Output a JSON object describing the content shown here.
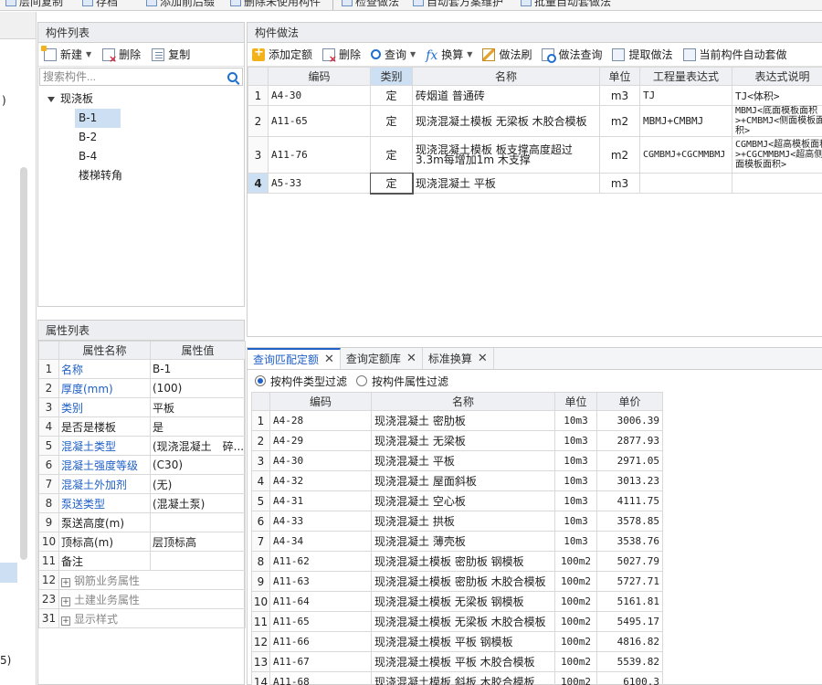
{
  "topbar": {
    "items": [
      "层间复制",
      "存档",
      "添加前后缀",
      "删除未使用构件",
      "检查做法",
      "自动套方案维护",
      "批量自动套做法"
    ]
  },
  "left_strip": {
    "glyph_a": ")",
    "glyph_b": "5)"
  },
  "component_list": {
    "title": "构件列表",
    "toolbar": {
      "new": "新建",
      "delete": "删除",
      "copy": "复制"
    },
    "search_placeholder": "搜索构件...",
    "tree": {
      "root": "现浇板",
      "children": [
        "B-1",
        "B-2",
        "B-4",
        "楼梯转角"
      ]
    }
  },
  "property_list": {
    "title": "属性列表",
    "headers": {
      "name": "属性名称",
      "value": "属性值"
    },
    "rows": [
      {
        "no": "1",
        "name": "名称",
        "value": "B-1"
      },
      {
        "no": "2",
        "name": "厚度(mm)",
        "value": "(100)"
      },
      {
        "no": "3",
        "name": "类别",
        "value": "平板"
      },
      {
        "no": "4",
        "name": "是否是楼板",
        "value": "是"
      },
      {
        "no": "5",
        "name": "混凝土类型",
        "value": "(现浇混凝土　碎..."
      },
      {
        "no": "6",
        "name": "混凝土强度等级",
        "value": "(C30)"
      },
      {
        "no": "7",
        "name": "混凝土外加剂",
        "value": "(无)"
      },
      {
        "no": "8",
        "name": "泵送类型",
        "value": "(混凝土泵)"
      },
      {
        "no": "9",
        "name": "泵送高度(m)",
        "value": ""
      },
      {
        "no": "10",
        "name": "顶标高(m)",
        "value": "层顶标高"
      },
      {
        "no": "11",
        "name": "备注",
        "value": ""
      },
      {
        "no": "12",
        "name": "钢筋业务属性",
        "value": ""
      },
      {
        "no": "23",
        "name": "土建业务属性",
        "value": ""
      },
      {
        "no": "31",
        "name": "显示样式",
        "value": ""
      }
    ]
  },
  "method_panel": {
    "title": "构件做法",
    "toolbar": {
      "add_quota": "添加定额",
      "delete": "删除",
      "query": "查询",
      "convert": "换算",
      "method_brush": "做法刷",
      "method_query": "做法查询",
      "extract": "提取做法",
      "auto_apply": "当前构件自动套做"
    },
    "headers": {
      "code": "编码",
      "type": "类别",
      "name": "名称",
      "unit": "单位",
      "expr": "工程量表达式",
      "desc": "表达式说明"
    },
    "rows": [
      {
        "no": "1",
        "code": "A4-30",
        "type": "定",
        "name": "砖烟道 普通砖",
        "unit": "m3",
        "expr": "TJ",
        "desc": "TJ<体积>"
      },
      {
        "no": "2",
        "code": "A11-65",
        "type": "定",
        "name": "现浇混凝土模板 无梁板 木胶合模板",
        "unit": "m2",
        "expr": "MBMJ+CMBMJ",
        "desc": "MBMJ<底面模板面积>+CMBMJ<侧面模板面积>"
      },
      {
        "no": "3",
        "code": "A11-76",
        "type": "定",
        "name": "现浇混凝土模板 板支撑高度超过3.3m每增加1m 木支撑",
        "unit": "m2",
        "expr": "CGMBMJ+CGCMMBMJ",
        "desc": "CGMBMJ<超高模板面积>+CGCMMBMJ<超高侧面模板面积>"
      },
      {
        "no": "4",
        "code": "A5-33",
        "type": "定",
        "name": "现浇混凝土 平板",
        "unit": "m3",
        "expr": "",
        "desc": ""
      }
    ]
  },
  "query_panel": {
    "tabs": [
      "查询匹配定额",
      "查询定额库",
      "标准换算"
    ],
    "radios": [
      "按构件类型过滤",
      "按构件属性过滤"
    ],
    "headers": {
      "code": "编码",
      "name": "名称",
      "unit": "单位",
      "price": "单价"
    },
    "rows": [
      {
        "no": "1",
        "code": "A4-28",
        "name": "现浇混凝土 密肋板",
        "unit": "10m3",
        "price": "3006.39"
      },
      {
        "no": "2",
        "code": "A4-29",
        "name": "现浇混凝土 无梁板",
        "unit": "10m3",
        "price": "2877.93"
      },
      {
        "no": "3",
        "code": "A4-30",
        "name": "现浇混凝土 平板",
        "unit": "10m3",
        "price": "2971.05"
      },
      {
        "no": "4",
        "code": "A4-32",
        "name": "现浇混凝土 屋面斜板",
        "unit": "10m3",
        "price": "3013.23"
      },
      {
        "no": "5",
        "code": "A4-31",
        "name": "现浇混凝土 空心板",
        "unit": "10m3",
        "price": "4111.75"
      },
      {
        "no": "6",
        "code": "A4-33",
        "name": "现浇混凝土 拱板",
        "unit": "10m3",
        "price": "3578.85"
      },
      {
        "no": "7",
        "code": "A4-34",
        "name": "现浇混凝土 薄壳板",
        "unit": "10m3",
        "price": "3538.76"
      },
      {
        "no": "8",
        "code": "A11-62",
        "name": "现浇混凝土模板 密肋板 钢模板",
        "unit": "100m2",
        "price": "5027.79"
      },
      {
        "no": "9",
        "code": "A11-63",
        "name": "现浇混凝土模板 密肋板 木胶合模板",
        "unit": "100m2",
        "price": "5727.71"
      },
      {
        "no": "10",
        "code": "A11-64",
        "name": "现浇混凝土模板 无梁板 钢模板",
        "unit": "100m2",
        "price": "5161.81"
      },
      {
        "no": "11",
        "code": "A11-65",
        "name": "现浇混凝土模板 无梁板 木胶合模板",
        "unit": "100m2",
        "price": "5495.17"
      },
      {
        "no": "12",
        "code": "A11-66",
        "name": "现浇混凝土模板 平板 钢模板",
        "unit": "100m2",
        "price": "4816.82"
      },
      {
        "no": "13",
        "code": "A11-67",
        "name": "现浇混凝土模板 平板 木胶合模板",
        "unit": "100m2",
        "price": "5539.82"
      },
      {
        "no": "14",
        "code": "A11-68",
        "name": "现浇混凝土模板 斜板 木胶合模板",
        "unit": "100m2",
        "price": "6100.3"
      }
    ]
  }
}
